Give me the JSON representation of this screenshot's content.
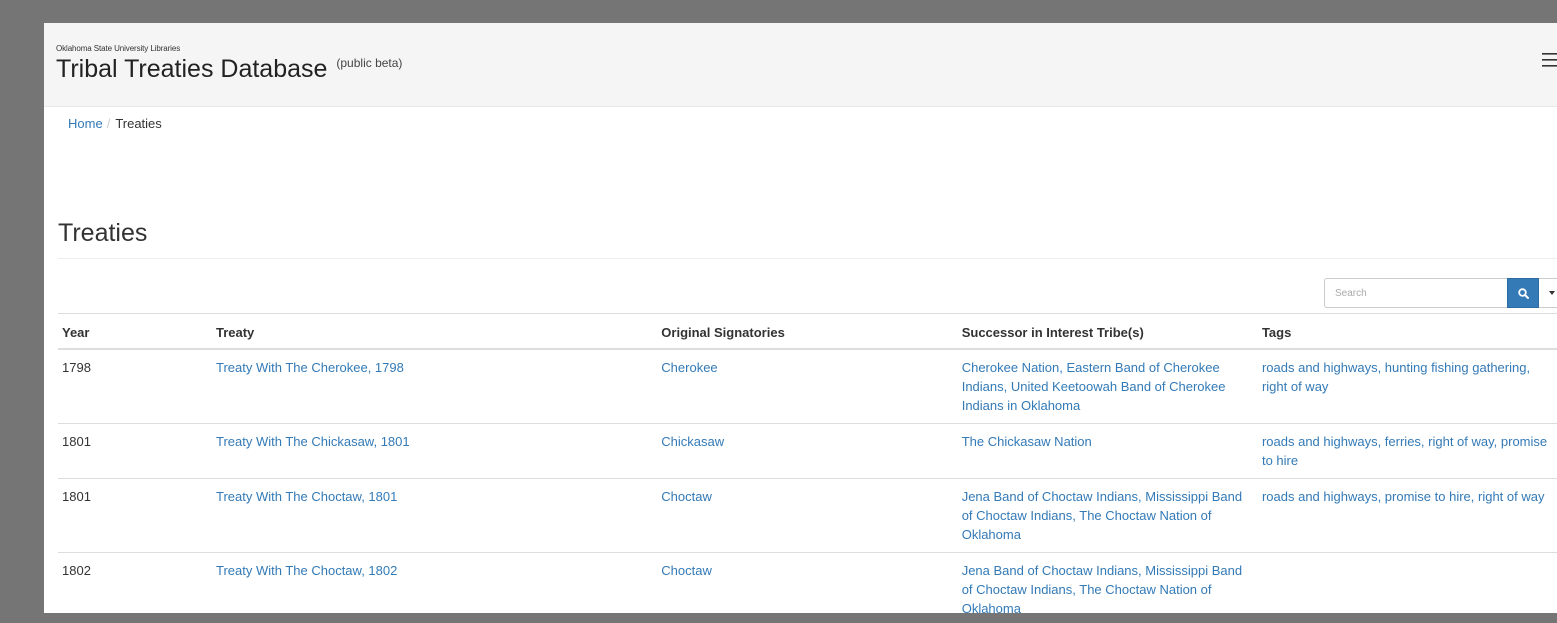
{
  "header": {
    "org": "Oklahoma State University Libraries",
    "title": "Tribal Treaties Database",
    "beta": "(public beta)"
  },
  "breadcrumb": {
    "home": "Home",
    "separator": "/",
    "current": "Treaties"
  },
  "page": {
    "title": "Treaties"
  },
  "search": {
    "placeholder": "Search"
  },
  "table": {
    "columns": [
      "Year",
      "Treaty",
      "Original Signatories",
      "Successor in Interest Tribe(s)",
      "Tags"
    ],
    "rows": [
      {
        "year": "1798",
        "treaty": "Treaty With The Cherokee, 1798",
        "original": "Cherokee",
        "successor": "Cherokee Nation, Eastern Band of Cherokee Indians, United Keetoowah Band of Cherokee Indians in Oklahoma",
        "tags": "roads and highways, hunting fishing gathering, right of way"
      },
      {
        "year": "1801",
        "treaty": "Treaty With The Chickasaw, 1801",
        "original": "Chickasaw",
        "successor": "The Chickasaw Nation",
        "tags": "roads and highways, ferries, right of way, promise to hire"
      },
      {
        "year": "1801",
        "treaty": "Treaty With The Choctaw, 1801",
        "original": "Choctaw",
        "successor": "Jena Band of Choctaw Indians, Mississippi Band of Choctaw Indians, The Choctaw Nation of Oklahoma",
        "tags": "roads and highways, promise to hire, right of way"
      },
      {
        "year": "1802",
        "treaty": "Treaty With The Choctaw, 1802",
        "original": "Choctaw",
        "successor": "Jena Band of Choctaw Indians, Mississippi Band of Choctaw Indians, The Choctaw Nation of Oklahoma",
        "tags": ""
      }
    ]
  },
  "colors": {
    "link": "#337ab7",
    "header_bg": "#f5f5f5",
    "outer_bg": "#757575"
  },
  "icons": {
    "menu": "hamburger-menu-icon",
    "search": "search-icon",
    "dropdown": "caret-down-icon"
  }
}
